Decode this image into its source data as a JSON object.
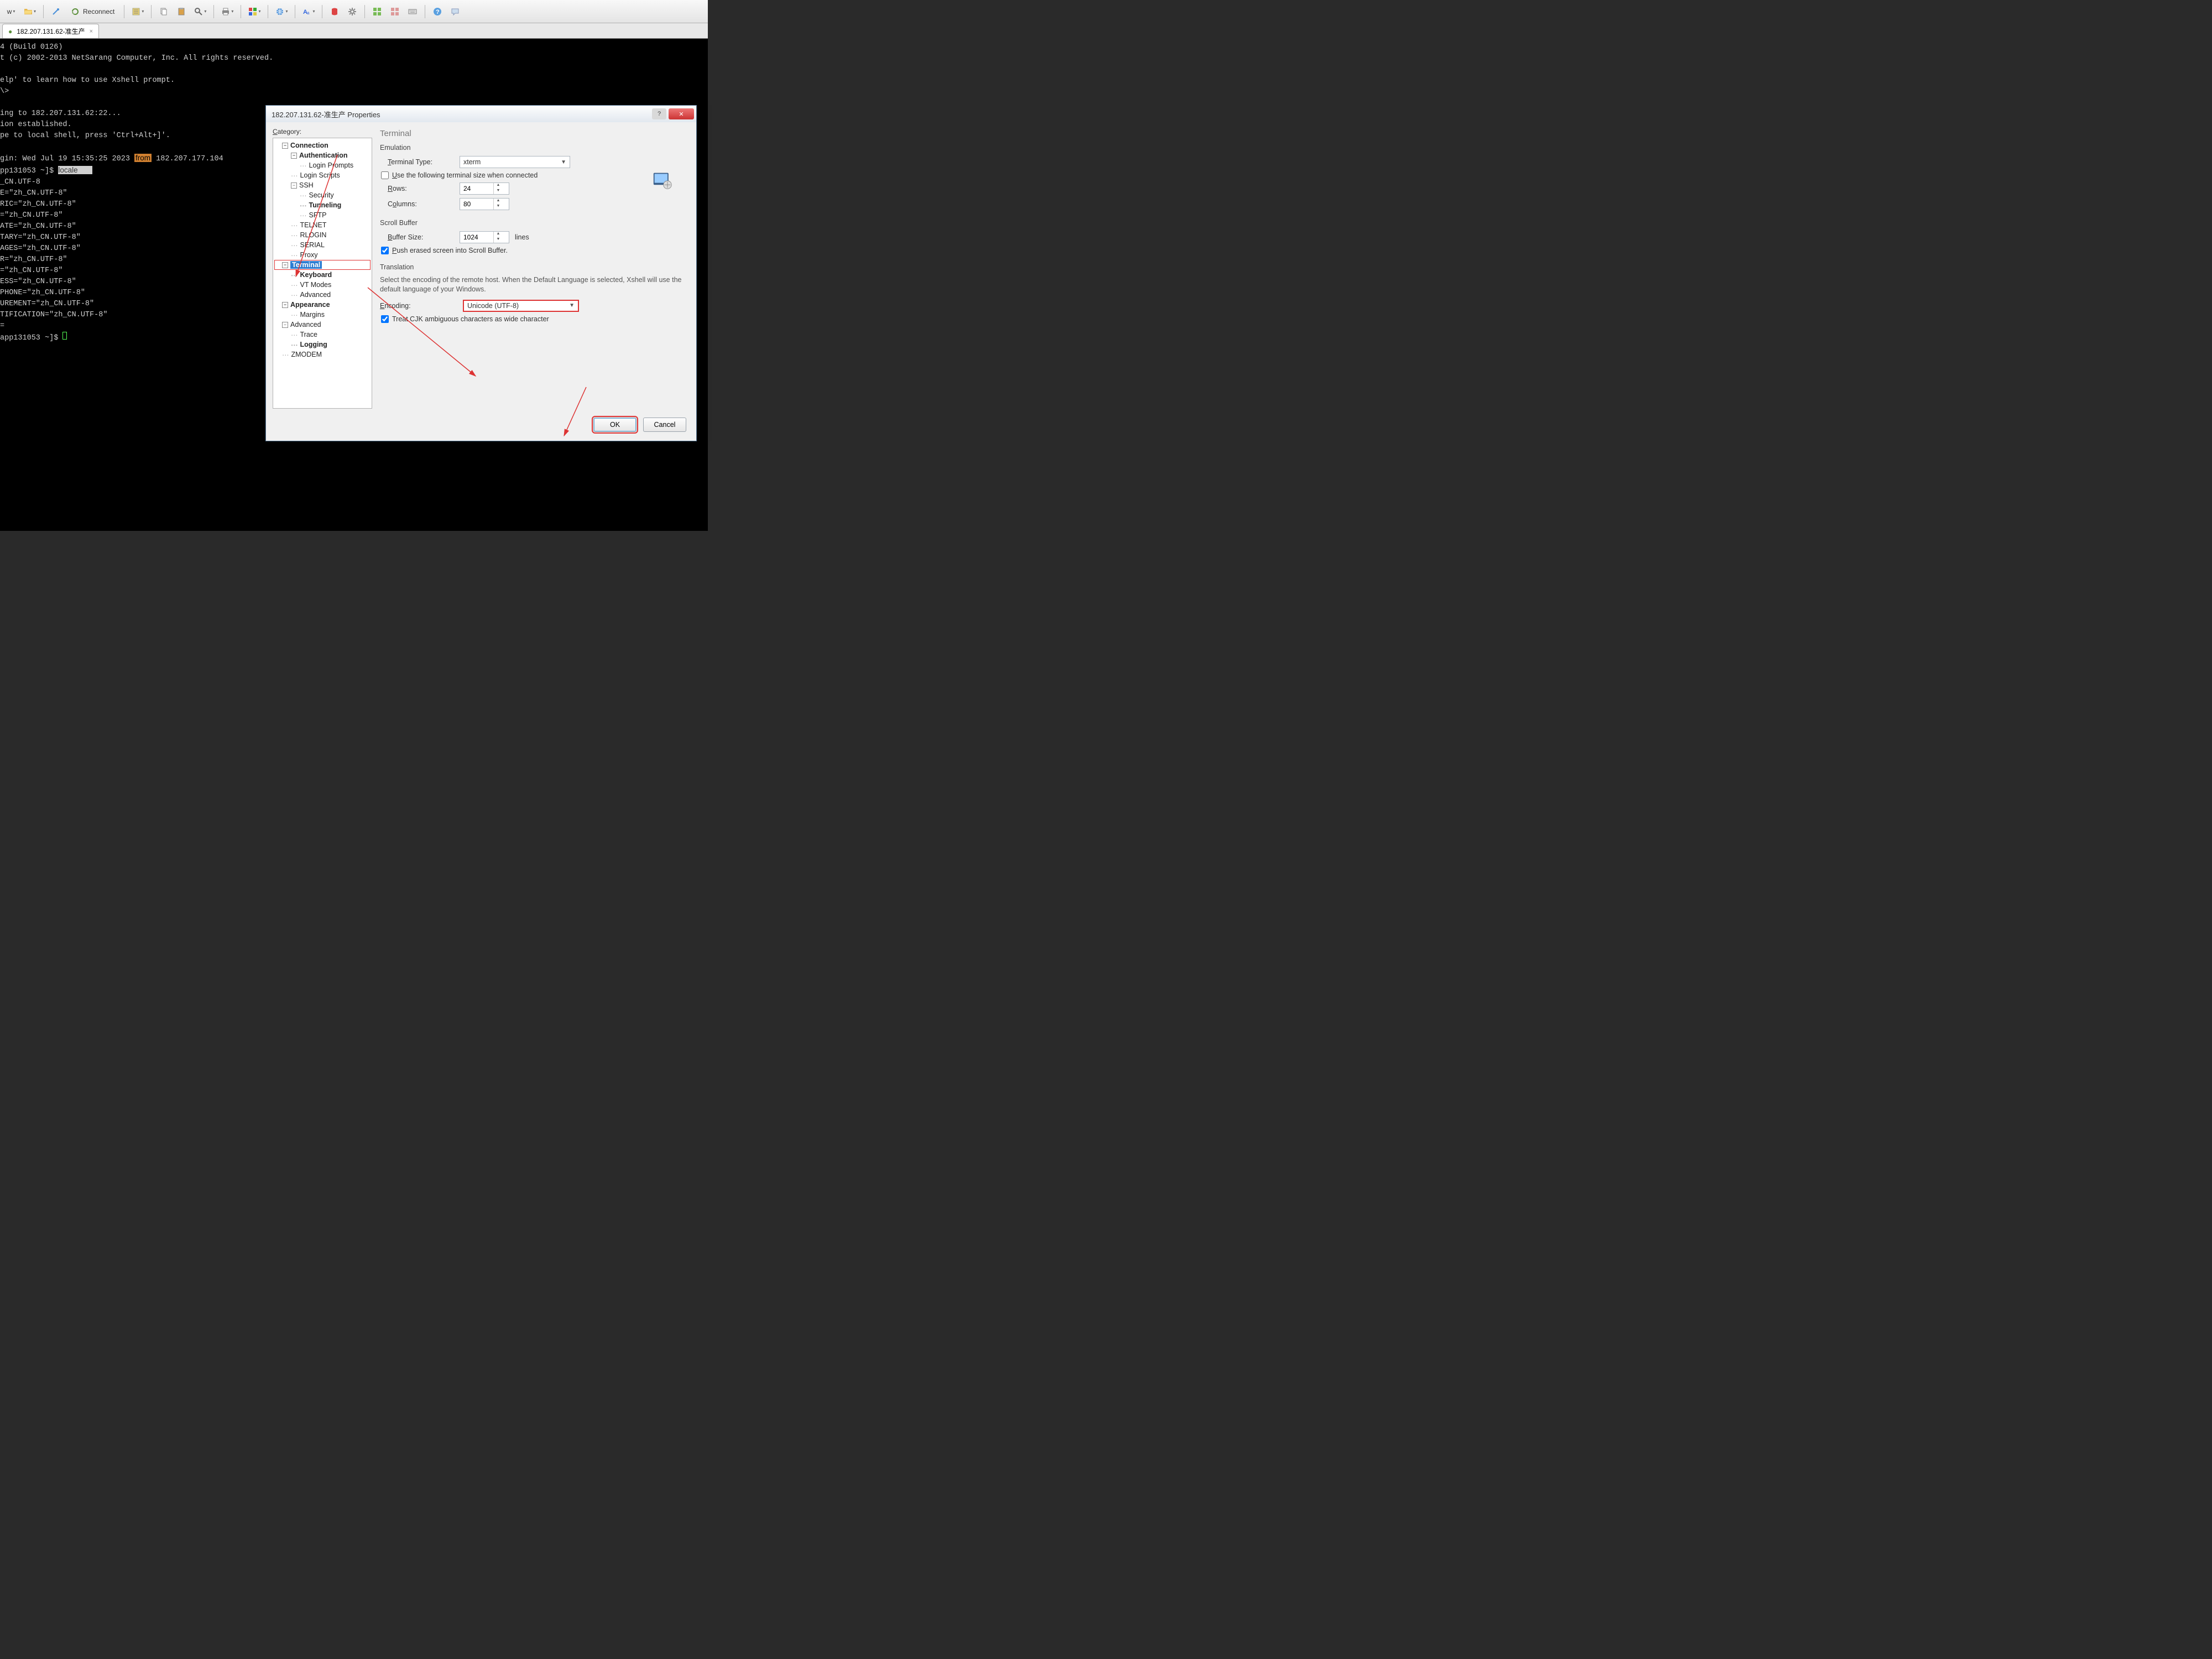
{
  "toolbar": {
    "reconnect": "Reconnect"
  },
  "tab": {
    "title": "182.207.131.62-准生产"
  },
  "terminal": {
    "lines": [
      "4 (Build 0126)",
      "t (c) 2002-2013 NetSarang Computer, Inc. All rights reserved.",
      "",
      "elp' to learn how to use Xshell prompt.",
      "\\>",
      "",
      "ing to 182.207.131.62:22...",
      "ion established.",
      "pe to local shell, press 'Ctrl+Alt+]'.",
      "",
      "gin: Wed Jul 19 15:35:25 2023 from 182.207.177.104",
      "pp131053 ~]$ ",
      "_CN.UTF-8",
      "E=\"zh_CN.UTF-8\"",
      "RIC=\"zh_CN.UTF-8\"",
      "=\"zh_CN.UTF-8\"",
      "ATE=\"zh_CN.UTF-8\"",
      "TARY=\"zh_CN.UTF-8\"",
      "AGES=\"zh_CN.UTF-8\"",
      "R=\"zh_CN.UTF-8\"",
      "=\"zh_CN.UTF-8\"",
      "ESS=\"zh_CN.UTF-8\"",
      "PHONE=\"zh_CN.UTF-8\"",
      "UREMENT=\"zh_CN.UTF-8\"",
      "TIFICATION=\"zh_CN.UTF-8\"",
      "=",
      "app131053 ~]$ "
    ],
    "cmd_highlight": "locale"
  },
  "dialog": {
    "title": "182.207.131.62-准生产 Properties",
    "category_label": "Category:",
    "tree": {
      "connection": "Connection",
      "authentication": "Authentication",
      "login_prompts": "Login Prompts",
      "login_scripts": "Login Scripts",
      "ssh": "SSH",
      "security": "Security",
      "tunneling": "Tunneling",
      "sftp": "SFTP",
      "telnet": "TELNET",
      "rlogin": "RLOGIN",
      "serial": "SERIAL",
      "proxy": "Proxy",
      "terminal": "Terminal",
      "keyboard": "Keyboard",
      "vt_modes": "VT Modes",
      "advanced": "Advanced",
      "appearance": "Appearance",
      "margins": "Margins",
      "advanced2": "Advanced",
      "trace": "Trace",
      "logging": "Logging",
      "zmodem": "ZMODEM"
    },
    "panel": {
      "heading": "Terminal",
      "emulation": "Emulation",
      "terminal_type_lbl": "Terminal Type:",
      "terminal_type_val": "xterm",
      "use_size_chk": "Use the following terminal size when connected",
      "rows_lbl": "Rows:",
      "rows_val": "24",
      "cols_lbl": "Columns:",
      "cols_val": "80",
      "scroll_buffer": "Scroll Buffer",
      "buffer_size_lbl": "Buffer Size:",
      "buffer_size_val": "1024",
      "buffer_unit": "lines",
      "push_chk": "Push erased screen into Scroll Buffer.",
      "translation": "Translation",
      "trans_desc": "Select the encoding of the remote host. When the Default Language is selected, Xshell will use the default language of your Windows.",
      "encoding_lbl": "Encoding:",
      "encoding_val": "Unicode (UTF-8)",
      "cjk_chk": "Treat CJK ambiguous characters as wide character"
    },
    "buttons": {
      "ok": "OK",
      "cancel": "Cancel"
    }
  }
}
